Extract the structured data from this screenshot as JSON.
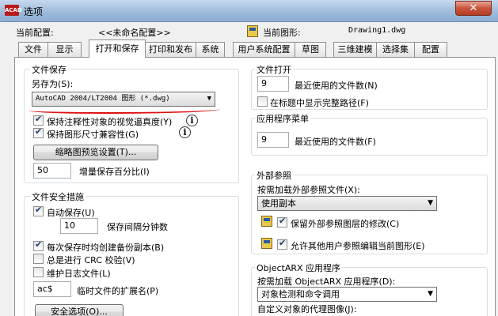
{
  "window": {
    "title": "选项",
    "app_icon": "autocad-logo-icon",
    "app_icon_text": "ACAD",
    "close_symbol": "✕"
  },
  "header": {
    "current_config_label": "当前配置:",
    "current_config_value": "<<未命名配置>>",
    "current_drawing_label": "当前图形:",
    "current_drawing_value": "Drawing1.dwg"
  },
  "tabs": [
    {
      "label": "文件",
      "active": false
    },
    {
      "label": "显示",
      "active": false
    },
    {
      "label": "打开和保存",
      "active": true
    },
    {
      "label": "打印和发布",
      "active": false
    },
    {
      "label": "系统",
      "active": false
    },
    {
      "label": "用户系统配置",
      "active": false
    },
    {
      "label": "草图",
      "active": false
    },
    {
      "label": "三维建模",
      "active": false
    },
    {
      "label": "选择集",
      "active": false
    },
    {
      "label": "配置",
      "active": false
    }
  ],
  "file_save": {
    "title": "文件保存",
    "save_as_label": "另存为(S):",
    "save_as_value": "AutoCAD 2004/LT2004 图形 (*.dwg)",
    "keep_annotative_label": "保持注释性对象的视觉逼真度(Y)",
    "keep_annotative_checked": true,
    "keep_drawing_size_label": "保持图形尺寸兼容性(G)",
    "keep_drawing_size_checked": true,
    "thumbnail_button": "缩略图预览设置(T)...",
    "incremental_value": "50",
    "incremental_label": "增量保存百分比(I)",
    "info_symbol": "i"
  },
  "file_safety": {
    "title": "文件安全措施",
    "autosave_label": "自动保存(U)",
    "autosave_checked": true,
    "autosave_minutes": "10",
    "autosave_minutes_label": "保存间隔分钟数",
    "backup_label": "每次保存时均创建备份副本(B)",
    "backup_checked": true,
    "crc_label": "总是进行 CRC 校验(V)",
    "crc_checked": false,
    "log_label": "维护日志文件(L)",
    "log_checked": false,
    "temp_ext_value": "ac$",
    "temp_ext_label": "临时文件的扩展名(P)",
    "security_button": "安全选项(O)..."
  },
  "file_open": {
    "title": "文件打开",
    "recent_files_value": "9",
    "recent_files_label": "最近使用的文件数(N)",
    "full_path_label": "在标题中显示完整路径(F)",
    "full_path_checked": false
  },
  "app_menu": {
    "title": "应用程序菜单",
    "recent_files_value": "9",
    "recent_files_label": "最近使用的文件数(F)"
  },
  "xref": {
    "title": "外部参照",
    "demand_load_label": "按需加载外部参照文件(X):",
    "demand_load_value": "使用副本",
    "retain_changes_label": "保留外部参照图层的修改(C)",
    "retain_changes_checked": true,
    "allow_edit_label": "允许其他用户参照编辑当前图形(E)",
    "allow_edit_checked": true
  },
  "objectarx": {
    "title": "ObjectARX 应用程序",
    "demand_load_label": "按需加载 ObjectARX 应用程序(D):",
    "demand_load_value": "对象检测和命令调用",
    "proxy_label": "自定义对象的代理图像(J):"
  }
}
